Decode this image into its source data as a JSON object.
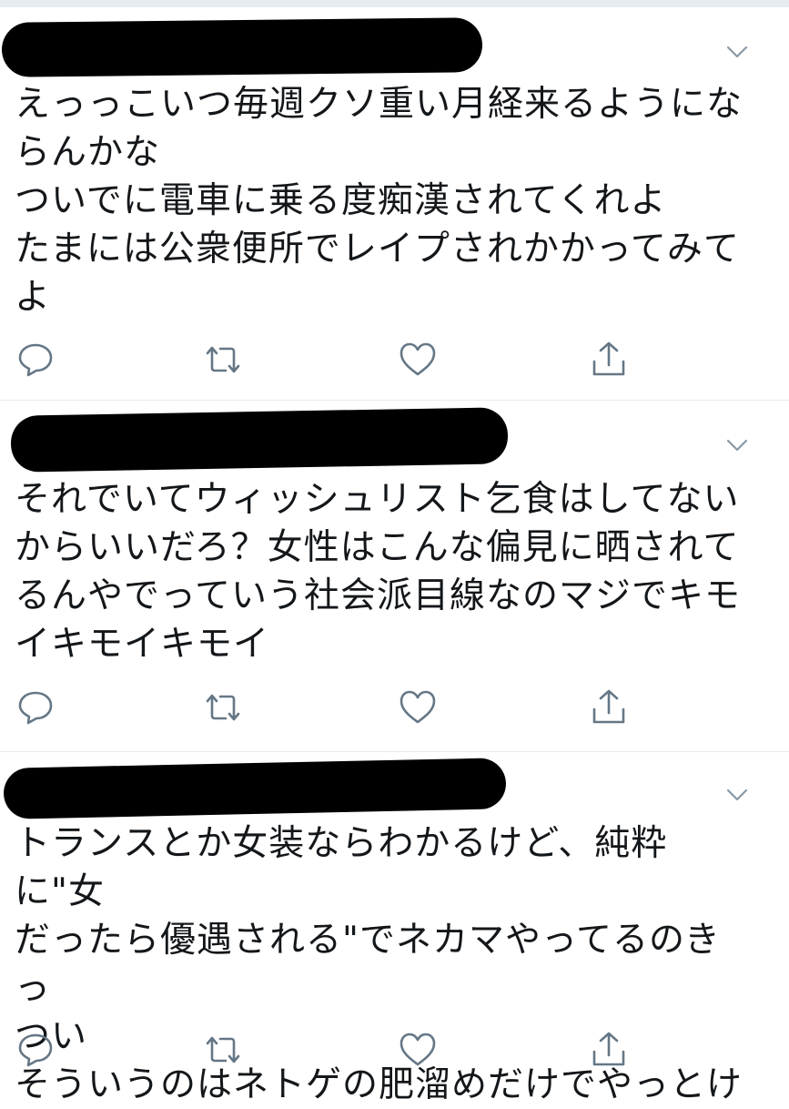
{
  "tweets": [
    {
      "text": "えっっこいつ毎週クソ重い月経来るようにな\nらんかな\nついでに電車に乗る度痴漢されてくれよ\nたまには公衆便所でレイプされかかってみて\nよ",
      "author": "redacted"
    },
    {
      "text": "それでいてウィッシュリスト乞食はしてない\nからいいだろ？女性はこんな偏見に晒されて\nるんやでっていう社会派目線なのマジでキモ\nイキモイキモイ",
      "author": "redacted"
    },
    {
      "text": "トランスとか女装ならわかるけど、純粋に\"女\nだったら優遇される\"でネカマやってるのきっ\nつい\nそういうのはネトゲの肥溜めだけでやっとけ",
      "author": "redacted"
    }
  ],
  "icons": {
    "reply": "reply-icon",
    "retweet": "retweet-icon",
    "like": "heart-icon",
    "share": "share-icon",
    "more": "chevron-down-icon"
  },
  "colors": {
    "icon": "#657786",
    "divider": "#e6ecf0",
    "text": "#14171a"
  }
}
